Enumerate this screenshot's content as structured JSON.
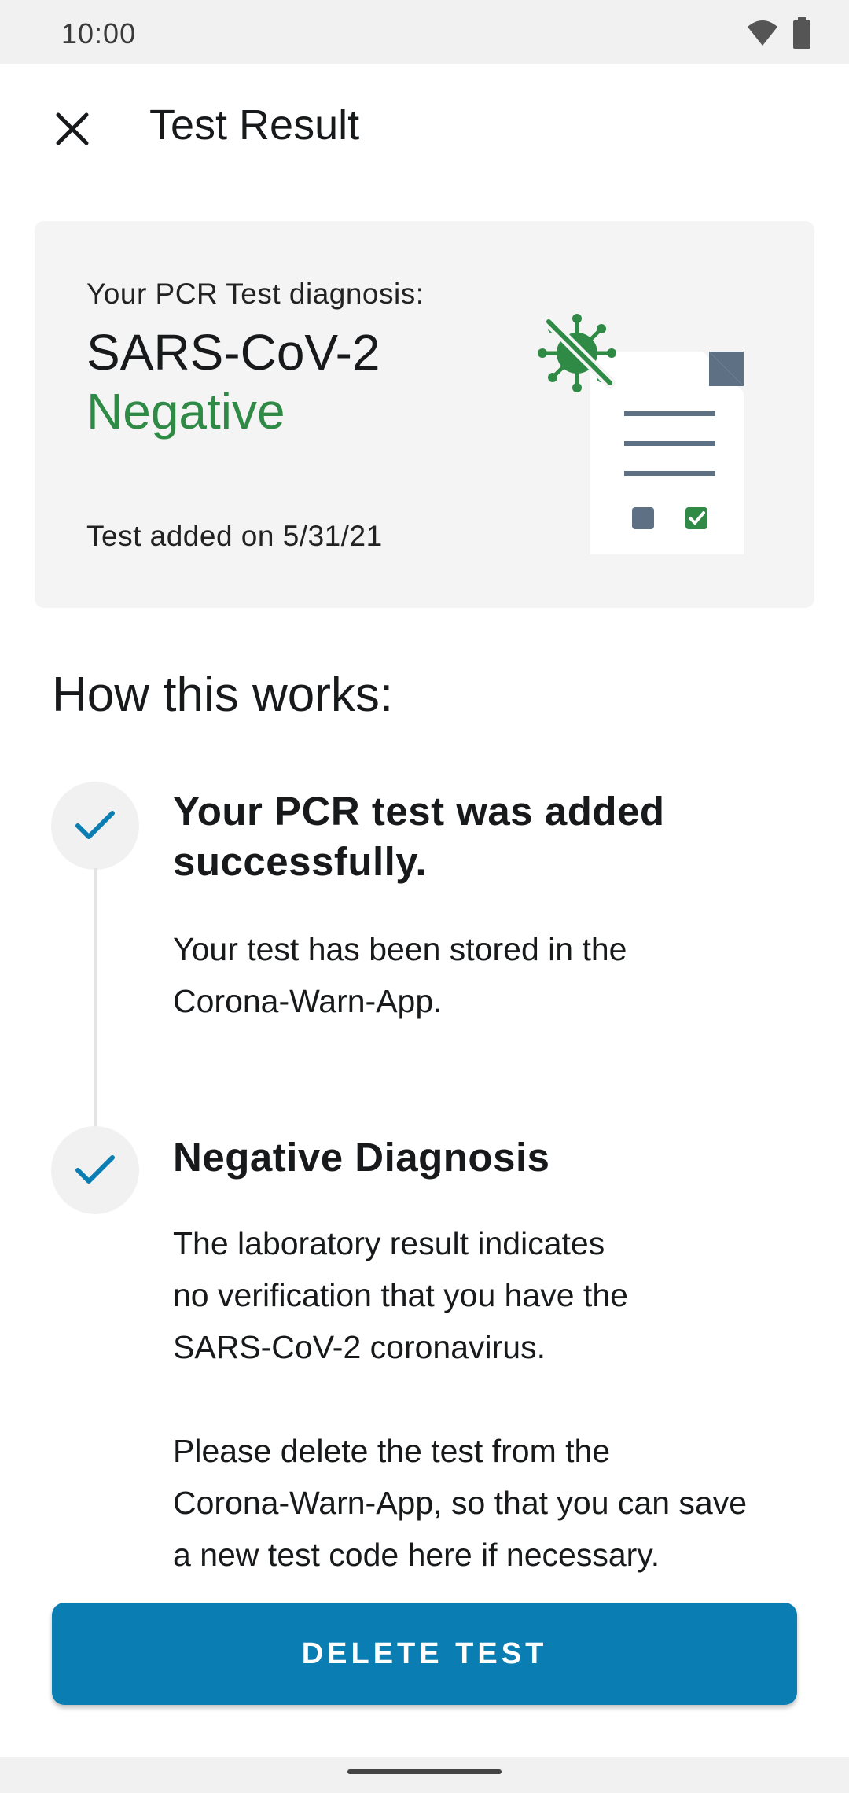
{
  "status_bar": {
    "time": "10:00",
    "icons": [
      "wifi-icon",
      "battery-icon"
    ]
  },
  "app_bar": {
    "close_icon": "close-icon",
    "title": "Test Result"
  },
  "result_card": {
    "label": "Your PCR Test diagnosis:",
    "virus": "SARS-CoV-2",
    "result": "Negative",
    "date_text": "Test added on 5/31/21",
    "illustration": "negative-test-document-illustration"
  },
  "how_it_works": {
    "heading": "How this works:",
    "steps": [
      {
        "icon": "checkmark-icon",
        "title_lines": [
          "Your PCR test was added",
          "successfully."
        ],
        "body_lines": [
          "Your test has been stored in the",
          "Corona-Warn-App."
        ]
      },
      {
        "icon": "checkmark-icon",
        "title_lines": [
          "Negative Diagnosis"
        ],
        "body_lines": [
          "The laboratory result indicates",
          "no verification that you have the",
          "SARS-CoV-2 coronavirus.",
          "Please delete the test from the",
          "Corona-Warn-App, so that you can save",
          "a new test code here if necessary."
        ]
      }
    ]
  },
  "actions": {
    "delete_label": "DELETE TEST"
  },
  "colors": {
    "accent": "#0a7eb3",
    "negative_green": "#2e8a45",
    "card_bg": "#f4f4f4",
    "illustration_slate": "#5e7184"
  }
}
